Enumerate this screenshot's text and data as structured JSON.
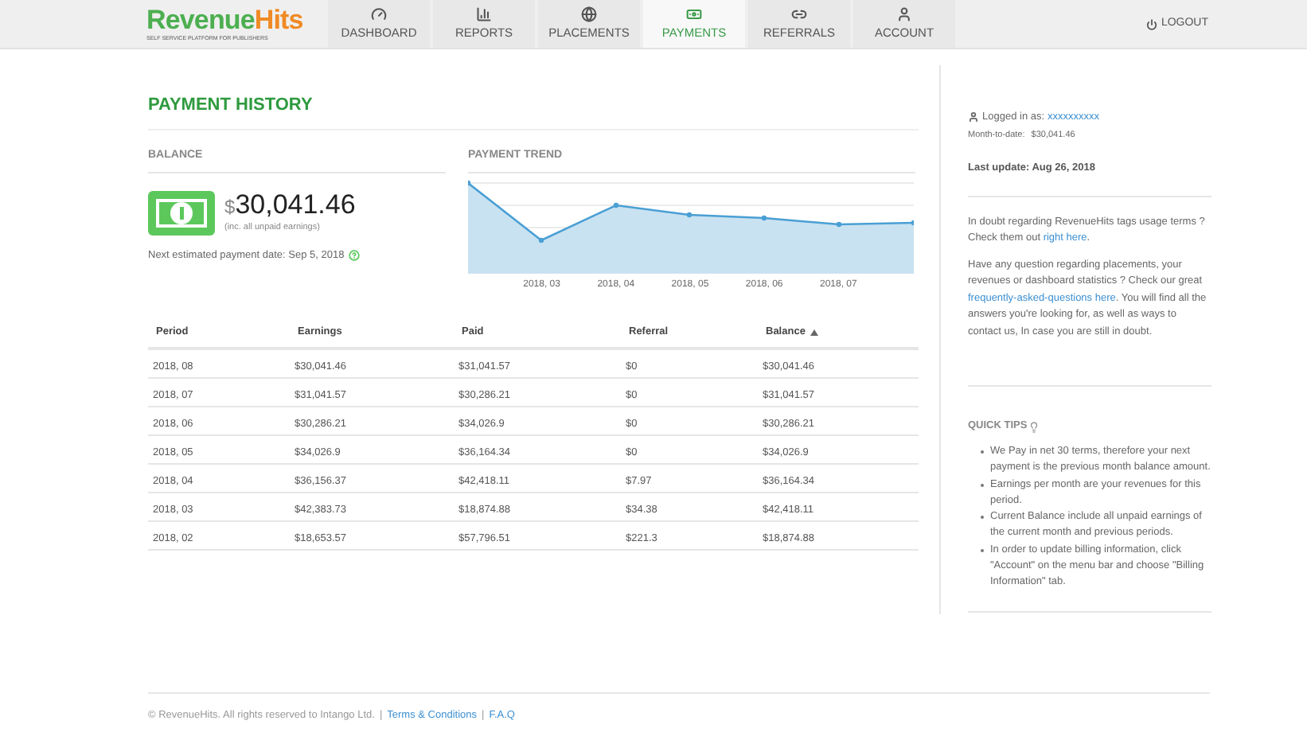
{
  "logo": {
    "name_a": "Revenue",
    "name_b": "Hits",
    "tagline": "SELF SERVICE PLATFORM FOR PUBLISHERS"
  },
  "nav": [
    {
      "label": "DASHBOARD",
      "selected": false
    },
    {
      "label": "REPORTS",
      "selected": false
    },
    {
      "label": "PLACEMENTS",
      "selected": false
    },
    {
      "label": "PAYMENTS",
      "selected": true
    },
    {
      "label": "REFERRALS",
      "selected": false
    },
    {
      "label": "ACCOUNT",
      "selected": false
    }
  ],
  "logout": "LOGOUT",
  "title": "PAYMENT HISTORY",
  "balance": {
    "heading": "BALANCE",
    "currency": "$",
    "amount": "30,041.46",
    "note": "(inc. all unpaid earnings)",
    "next_payment": "Next estimated payment date: Sep 5, 2018"
  },
  "trend": {
    "heading": "PAYMENT TREND",
    "x_labels": [
      "2018, 03",
      "2018, 04",
      "2018, 05",
      "2018, 06",
      "2018, 07"
    ]
  },
  "table": {
    "columns": [
      {
        "label": "Period",
        "sorted": false
      },
      {
        "label": "Earnings",
        "sorted": false
      },
      {
        "label": "Paid",
        "sorted": false
      },
      {
        "label": "Referral",
        "sorted": false
      },
      {
        "label": "Balance",
        "sorted": true
      }
    ],
    "rows": [
      [
        "2018, 08",
        "$30,041.46",
        "$31,041.57",
        "$0",
        "$30,041.46"
      ],
      [
        "2018, 07",
        "$31,041.57",
        "$30,286.21",
        "$0",
        "$31,041.57"
      ],
      [
        "2018, 06",
        "$30,286.21",
        "$34,026.9",
        "$0",
        "$30,286.21"
      ],
      [
        "2018, 05",
        "$34,026.9",
        "$36,164.34",
        "$0",
        "$34,026.9"
      ],
      [
        "2018, 04",
        "$36,156.37",
        "$42,418.11",
        "$7.97",
        "$36,164.34"
      ],
      [
        "2018, 03",
        "$42,383.73",
        "$18,874.88",
        "$34.38",
        "$42,418.11"
      ],
      [
        "2018, 02",
        "$18,653.57",
        "$57,796.51",
        "$221.3",
        "$18,874.88"
      ]
    ]
  },
  "sidebar": {
    "logged_in": "Logged in as:",
    "user": "xxxxxxxxxx",
    "mtd_label": "Month-to-date:",
    "mtd_value": "$30,041.46",
    "last_update": "Last update: Aug 26, 2018",
    "paragraphs": [
      {
        "before": "In doubt regarding RevenueHits tags usage terms ? Check them out ",
        "link": "right here",
        "after": "."
      },
      {
        "before": "Have any question regarding placements, your revenues or dashboard statistics ? Check our great ",
        "link": "frequently-asked-questions here",
        "after": ". You will find all the answers you're looking for, as well as ways to contact us, In case you are still in doubt."
      }
    ],
    "tips_heading": "QUICK TIPS",
    "tips": [
      "We Pay in net 30 terms, therefore your next payment is the previous month balance amount.",
      "Earnings per month are your revenues for this period.",
      "Current Balance include all unpaid earnings of the current month and previous periods.",
      "In order to update billing information, click \"Account\" on the menu bar and choose \"Billing Information\" tab."
    ]
  },
  "footer": {
    "copyright": "© RevenueHits. All rights reserved to Intango Ltd.",
    "links": [
      "Terms & Conditions",
      "F.A.Q"
    ],
    "separator": "|"
  }
}
